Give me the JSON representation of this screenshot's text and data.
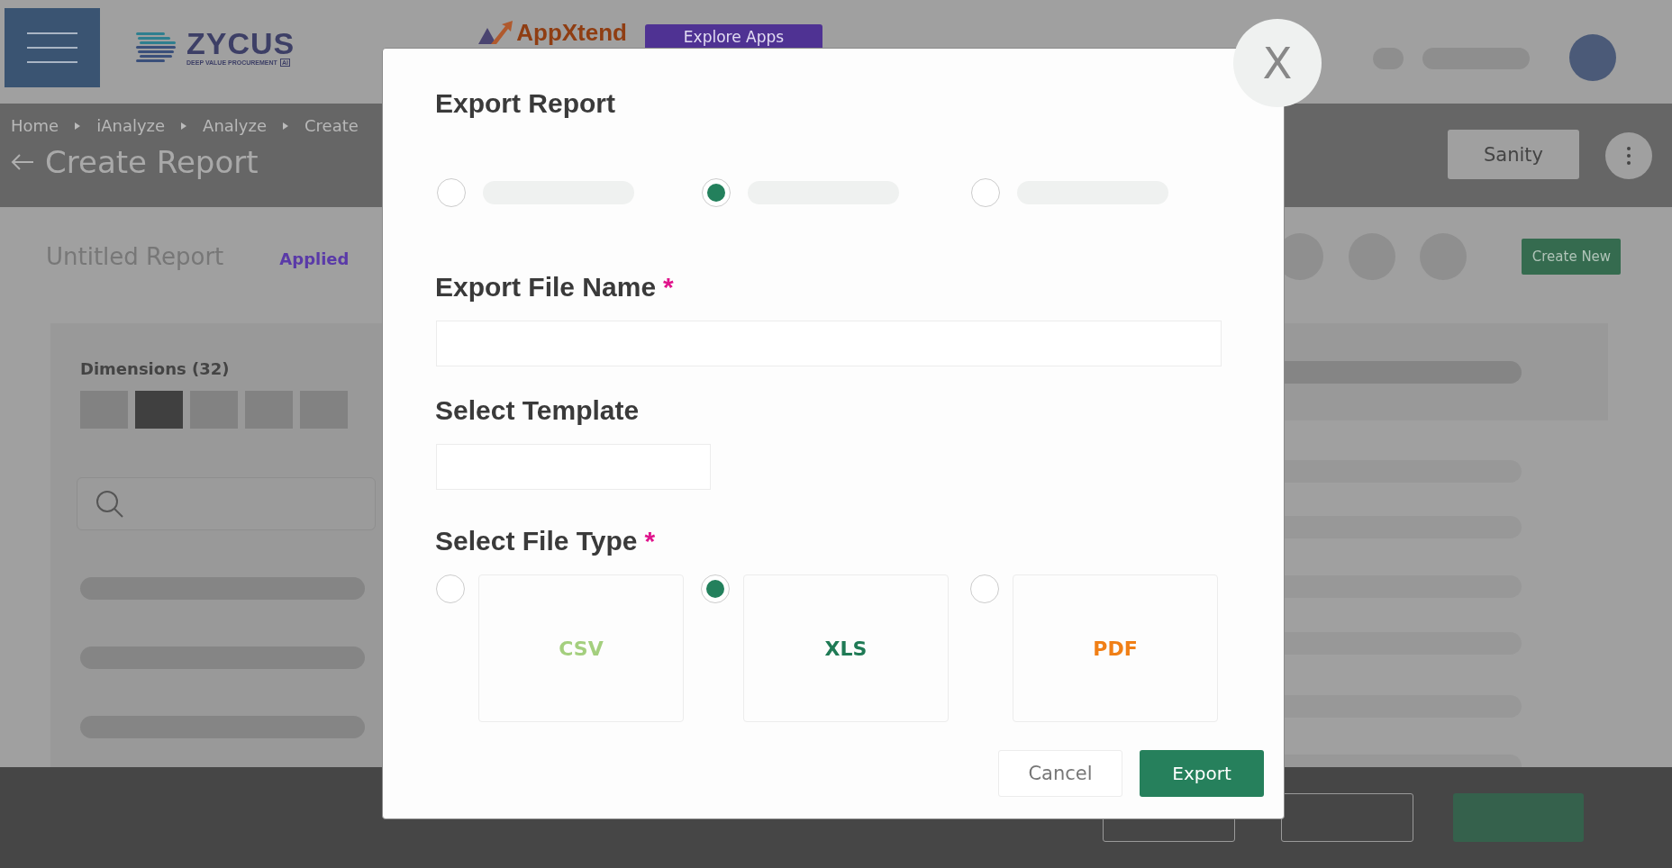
{
  "header": {
    "logo": {
      "name": "ZYCUS",
      "tagline": "DEEP VALUE PROCUREMENT",
      "badge": "AI"
    },
    "app_logo": "AppXtend",
    "explore_button": "Explore Apps"
  },
  "breadcrumbs": [
    "Home",
    "iAnalyze",
    "Analyze",
    "Create"
  ],
  "page_title": "Create Report",
  "sanity_button": "Sanity",
  "report_name": "Untitled Report",
  "applied_label": "Applied",
  "create_new_button": "Create New",
  "dimensions": {
    "title": "Dimensions (32)",
    "tabs": [
      {
        "selected": false
      },
      {
        "selected": true
      },
      {
        "selected": false
      },
      {
        "selected": false
      },
      {
        "selected": false
      }
    ]
  },
  "dialog": {
    "title": "Export Report",
    "close": "X",
    "required_mark": "*",
    "scope_options": [
      {
        "selected": false
      },
      {
        "selected": true
      },
      {
        "selected": false
      }
    ],
    "fields": [
      {
        "label": "Export File Name",
        "required": true,
        "kind": "wide"
      },
      {
        "label": "Select Template",
        "required": false,
        "kind": "narrow"
      }
    ],
    "file_type": {
      "label": "Select File Type",
      "required": true,
      "options": [
        {
          "label": "CSV",
          "color": "#a4cf7e",
          "selected": false
        },
        {
          "label": "XLS",
          "color": "#1f7a55",
          "selected": true
        },
        {
          "label": "PDF",
          "color": "#f07f16",
          "selected": false
        }
      ]
    },
    "buttons": {
      "cancel": "Cancel",
      "export": "Export"
    }
  }
}
